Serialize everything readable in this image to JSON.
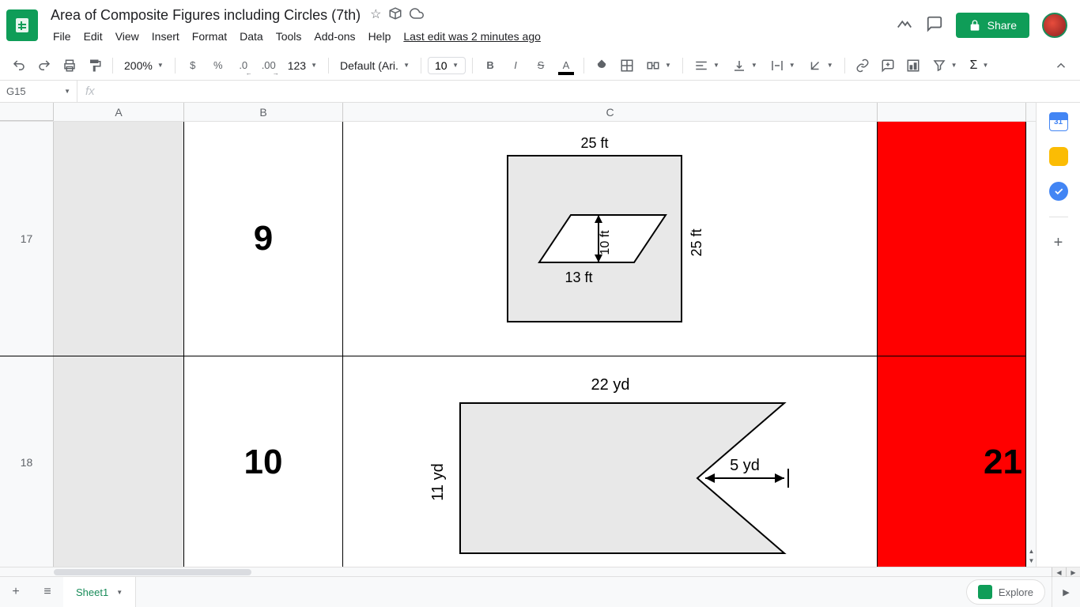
{
  "app": {
    "doc_title": "Area of Composite Figures including Circles (7th)",
    "last_edit": "Last edit was 2 minutes ago"
  },
  "menubar": {
    "file": "File",
    "edit": "Edit",
    "view": "View",
    "insert": "Insert",
    "format": "Format",
    "data": "Data",
    "tools": "Tools",
    "addons": "Add-ons",
    "help": "Help"
  },
  "toolbar": {
    "zoom": "200%",
    "currency": "$",
    "percent": "%",
    "dec_dec": ".0",
    "dec_inc": ".00",
    "num_format": "123",
    "font": "Default (Ari...",
    "font_size": "10"
  },
  "share": {
    "label": "Share"
  },
  "formula": {
    "name_box": "G15",
    "fx": "fx",
    "value": ""
  },
  "columns": {
    "A": "A",
    "B": "B",
    "C": "C"
  },
  "rows": {
    "r17": {
      "hdr": "17",
      "b": "9",
      "c_figure": {
        "top": "25 ft",
        "right": "25 ft",
        "inner_h": "10 ft",
        "inner_base": "13 ft"
      },
      "d": ""
    },
    "r18": {
      "hdr": "18",
      "b": "10",
      "c_figure": {
        "top": "22 yd",
        "left": "11 yd",
        "notch": "5 yd"
      },
      "d": "21"
    }
  },
  "side_cal_day": "31",
  "sheet_tab": "Sheet1",
  "explore": "Explore"
}
